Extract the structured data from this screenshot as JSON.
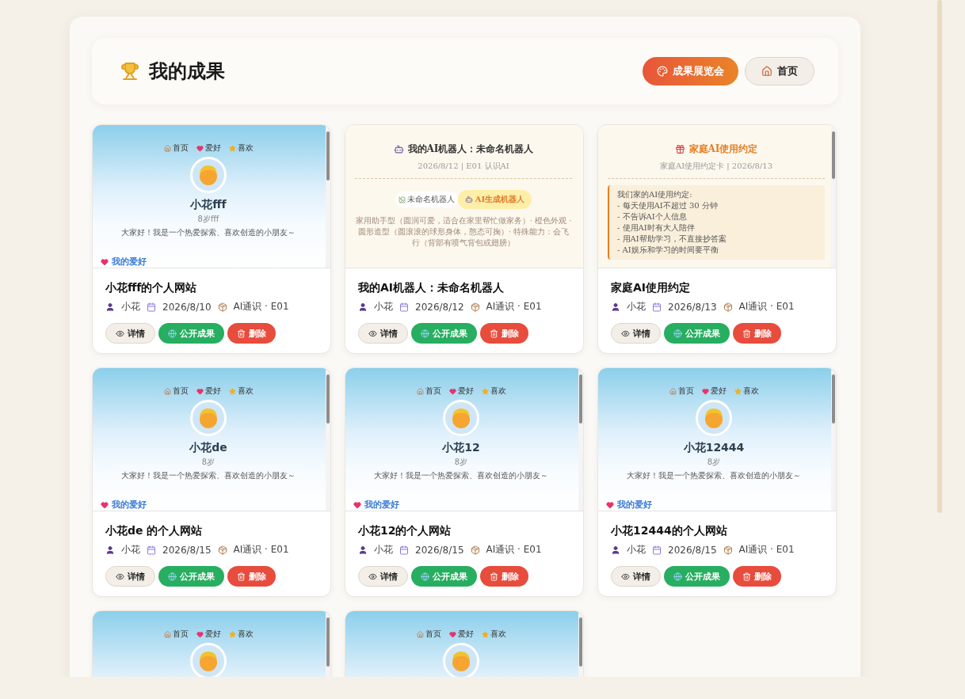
{
  "header": {
    "title": "我的成果",
    "buttons": [
      {
        "label": "成果展览会",
        "kind": "primary"
      },
      {
        "label": "首页",
        "kind": "secondary"
      }
    ]
  },
  "cards": [
    {
      "preview": {
        "kind": "profile",
        "nav": [
          {
            "label": "首页",
            "kind": "home"
          },
          {
            "label": "爱好",
            "kind": "heart"
          },
          {
            "label": "喜欢",
            "kind": "star"
          }
        ],
        "name": "小花fff",
        "age": "8岁fff",
        "bio": "大家好！我是一个热爱探索、喜欢创造的小朋友～",
        "section": "我的爱好"
      },
      "title": "小花fff的个人网站",
      "author": "小花",
      "date": "2026/8/10",
      "course": "AI通识 · E01",
      "actions": [
        {
          "label": "详情",
          "kind": "detail"
        },
        {
          "label": "公开成果",
          "kind": "publish"
        },
        {
          "label": "删除",
          "kind": "delete"
        }
      ]
    },
    {
      "preview": {
        "kind": "robot",
        "title": "我的AI机器人：未命名机器人",
        "meta": "2026/8/12 | E01 认识AI",
        "image_alt": "未命名机器人",
        "badge": "AI生成机器人",
        "description": "家用助手型（圆润可爱，适合在家里帮忙做家务）· 橙色外观 · 圆形造型（圆滚滚的球形身体，憨态可掬）· 特殊能力：会飞行（背部有喷气背包或翅膀）"
      },
      "title": "我的AI机器人：未命名机器人",
      "author": "小花",
      "date": "2026/8/12",
      "course": "AI通识 · E01",
      "actions": [
        {
          "label": "详情",
          "kind": "detail"
        },
        {
          "label": "公开成果",
          "kind": "publish"
        },
        {
          "label": "删除",
          "kind": "delete"
        }
      ]
    },
    {
      "preview": {
        "kind": "rules",
        "title": "家庭AI使用约定",
        "meta": "家庭AI使用约定卡 | 2026/8/13",
        "lines": [
          "我们家的AI使用约定:",
          "- 每天使用AI不超过 30 分钟",
          "- 不告诉AI个人信息",
          "- 使用AI时有大人陪伴",
          "- 用AI帮助学习，不直接抄答案",
          "- AI娱乐和学习的时间要平衡"
        ]
      },
      "title": "家庭AI使用约定",
      "author": "小花",
      "date": "2026/8/13",
      "course": "AI通识 · E01",
      "actions": [
        {
          "label": "详情",
          "kind": "detail"
        },
        {
          "label": "公开成果",
          "kind": "publish"
        },
        {
          "label": "删除",
          "kind": "delete"
        }
      ]
    },
    {
      "preview": {
        "kind": "profile",
        "nav": [
          {
            "label": "首页",
            "kind": "home"
          },
          {
            "label": "爱好",
            "kind": "heart"
          },
          {
            "label": "喜欢",
            "kind": "star"
          }
        ],
        "name": "小花de",
        "age": "8岁",
        "bio": "大家好！我是一个热爱探索、喜欢创造的小朋友～",
        "section": "我的爱好"
      },
      "title": "小花de 的个人网站",
      "author": "小花",
      "date": "2026/8/15",
      "course": "AI通识 · E01",
      "actions": [
        {
          "label": "详情",
          "kind": "detail"
        },
        {
          "label": "公开成果",
          "kind": "publish"
        },
        {
          "label": "删除",
          "kind": "delete"
        }
      ]
    },
    {
      "preview": {
        "kind": "profile",
        "nav": [
          {
            "label": "首页",
            "kind": "home"
          },
          {
            "label": "爱好",
            "kind": "heart"
          },
          {
            "label": "喜欢",
            "kind": "star"
          }
        ],
        "name": "小花12",
        "age": "8岁",
        "bio": "大家好！我是一个热爱探索、喜欢创造的小朋友～",
        "section": "我的爱好"
      },
      "title": "小花12的个人网站",
      "author": "小花",
      "date": "2026/8/15",
      "course": "AI通识 · E01",
      "actions": [
        {
          "label": "详情",
          "kind": "detail"
        },
        {
          "label": "公开成果",
          "kind": "publish"
        },
        {
          "label": "删除",
          "kind": "delete"
        }
      ]
    },
    {
      "preview": {
        "kind": "profile",
        "nav": [
          {
            "label": "首页",
            "kind": "home"
          },
          {
            "label": "爱好",
            "kind": "heart"
          },
          {
            "label": "喜欢",
            "kind": "star"
          }
        ],
        "name": "小花12444",
        "age": "8岁",
        "bio": "大家好！我是一个热爱探索、喜欢创造的小朋友～",
        "section": "我的爱好"
      },
      "title": "小花12444的个人网站",
      "author": "小花",
      "date": "2026/8/15",
      "course": "AI通识 · E01",
      "actions": [
        {
          "label": "详情",
          "kind": "detail"
        },
        {
          "label": "公开成果",
          "kind": "publish"
        },
        {
          "label": "删除",
          "kind": "delete"
        }
      ]
    },
    {
      "preview": {
        "kind": "profile",
        "nav": [
          {
            "label": "首页",
            "kind": "home"
          },
          {
            "label": "爱好",
            "kind": "heart"
          },
          {
            "label": "喜欢",
            "kind": "star"
          }
        ]
      }
    },
    {
      "preview": {
        "kind": "profile",
        "nav": [
          {
            "label": "首页",
            "kind": "home"
          },
          {
            "label": "爱好",
            "kind": "heart"
          },
          {
            "label": "喜欢",
            "kind": "star"
          }
        ]
      }
    }
  ]
}
